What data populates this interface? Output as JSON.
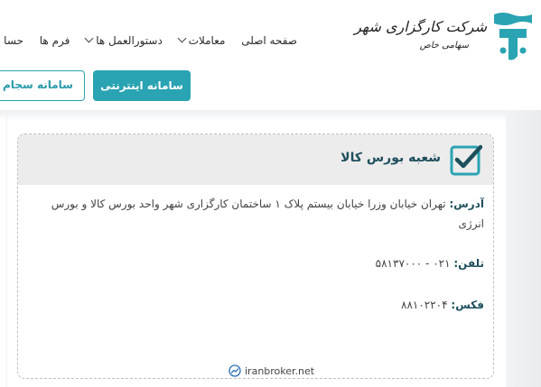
{
  "logo": {
    "title": "شرکت کارگزاری شهر",
    "subtitle": "سهامی خاص",
    "brand_color": "#2aa3b3"
  },
  "nav": {
    "items": [
      {
        "label": "صفحه اصلی",
        "dropdown": false
      },
      {
        "label": "معاملات",
        "dropdown": true
      },
      {
        "label": "دستورالعمل ها",
        "dropdown": true
      },
      {
        "label": "فرم ها",
        "dropdown": false
      },
      {
        "label": "حسا",
        "dropdown": false
      }
    ]
  },
  "buttons": {
    "internet_system": "سامانه اینترنتی",
    "sejam_system": "سامانه سجام"
  },
  "card": {
    "title": "شعبه بورس کالا",
    "address_label": "آدرس:",
    "address_value": "تهران خیابان وزرا خیابان بیستم پلاک ۱ ساختمان کارگزاری شهر واحد بورس کالا و بورس انرژی",
    "phone_label": "تلفن:",
    "phone_value": "۰۲۱ - ۵۸۱۳۷۰۰۰",
    "fax_label": "فکس:",
    "fax_value": "۸۸۱۰۲۲۰۴"
  },
  "footer": {
    "brand": "iranbroker.net"
  },
  "colors": {
    "accent": "#2aa3b3",
    "heading": "#1e4f5c",
    "card_header_bg": "#ececec"
  }
}
